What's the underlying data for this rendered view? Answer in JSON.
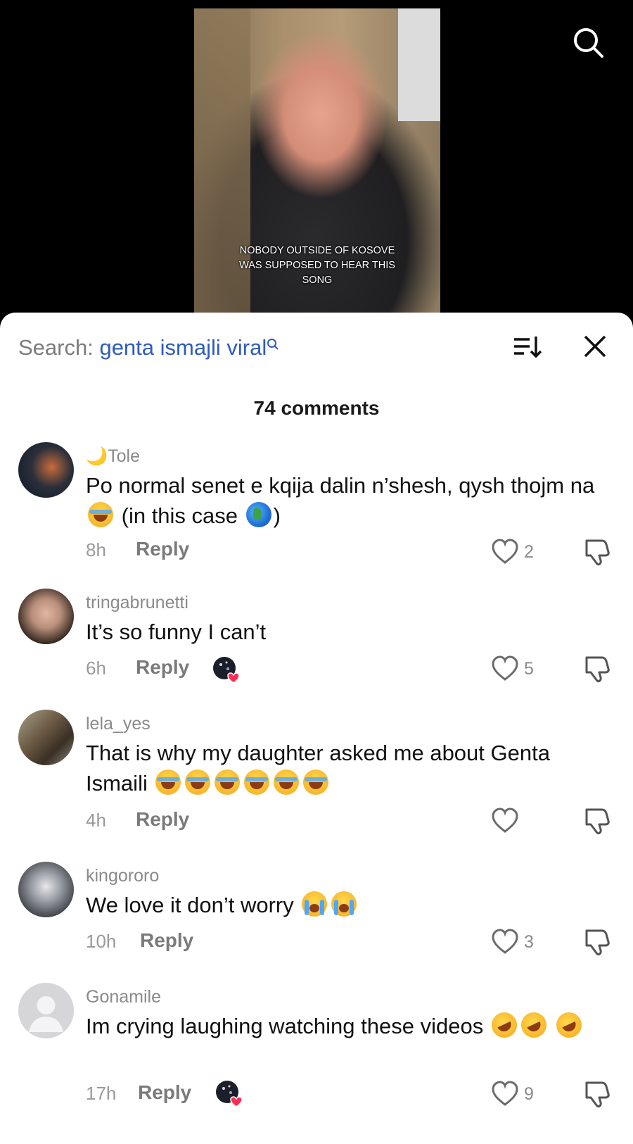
{
  "video": {
    "caption_lines": [
      "NOBODY OUTSIDE OF KOSOVE",
      "WAS SUPPOSED TO HEAR THIS",
      "SONG"
    ],
    "search_icon": "search-icon"
  },
  "comments_sheet": {
    "search_prefix": "Search: ",
    "search_term": "genta ismajli viral",
    "search_suffix_icon": "search-small-icon",
    "sort_icon": "sort-icon",
    "close_icon": "close-icon",
    "count_label": "74 comments"
  },
  "comments": [
    {
      "username": "🌙Tole",
      "text_before": "Po normal senet e kqija dalin n’shesh, qysh thojm na",
      "text_middle": "(in this case",
      "text_after": ")",
      "emojis": [
        "laughing-tears-emoji",
        "globe-emoji"
      ],
      "time": "8h",
      "reply_label": "Reply",
      "like_count": "2",
      "avatar_color": "#1d2a3a"
    },
    {
      "username": "tringabrunetti",
      "text": "It’s so funny I can’t",
      "time": "6h",
      "reply_label": "Reply",
      "like_count": "5",
      "creator_liked": true,
      "avatar_color": "#b98f7b"
    },
    {
      "username": "lela_yes",
      "text": "That is why my daughter asked me about Genta Ismaili",
      "emojis": [
        "laughing-tears-emoji",
        "laughing-tears-emoji",
        "laughing-tears-emoji",
        "laughing-tears-emoji",
        "laughing-tears-emoji",
        "laughing-tears-emoji"
      ],
      "time": "4h",
      "reply_label": "Reply",
      "like_count": "",
      "avatar_color": "#7e6a4d"
    },
    {
      "username": "kingororo",
      "text": "We love it don’t worry",
      "emojis": [
        "loudly-crying-emoji",
        "loudly-crying-emoji"
      ],
      "time": "10h",
      "reply_label": "Reply",
      "like_count": "3",
      "avatar_color": "#7a7f86"
    },
    {
      "username": "Gonamile",
      "text": "Im crying laughing watching these videos",
      "emojis": [
        "rofl-emoji",
        "rofl-emoji",
        "rofl-emoji"
      ],
      "time": "17h",
      "reply_label": "Reply",
      "like_count": "9",
      "creator_liked": true,
      "avatar_color": "#d6d6d8"
    }
  ],
  "icons": {
    "like": "heart-outline-icon",
    "dislike": "thumbs-down-icon"
  }
}
